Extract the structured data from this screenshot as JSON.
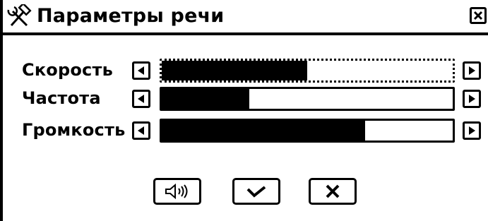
{
  "window": {
    "title": "Параметры речи",
    "title_icon": "tools-icon",
    "close_icon": "close-icon"
  },
  "params": [
    {
      "label": "Скорость",
      "level_percent": 50,
      "focused": true
    },
    {
      "label": "Частота",
      "level_percent": 30,
      "focused": false
    },
    {
      "label": "Громкость",
      "level_percent": 70,
      "focused": false
    }
  ],
  "buttons": {
    "speak_icon": "speaker-icon",
    "ok_icon": "checkmark-icon",
    "cancel_icon": "x-icon"
  },
  "colors": {
    "foreground": "#000000",
    "background": "#ffffff"
  }
}
